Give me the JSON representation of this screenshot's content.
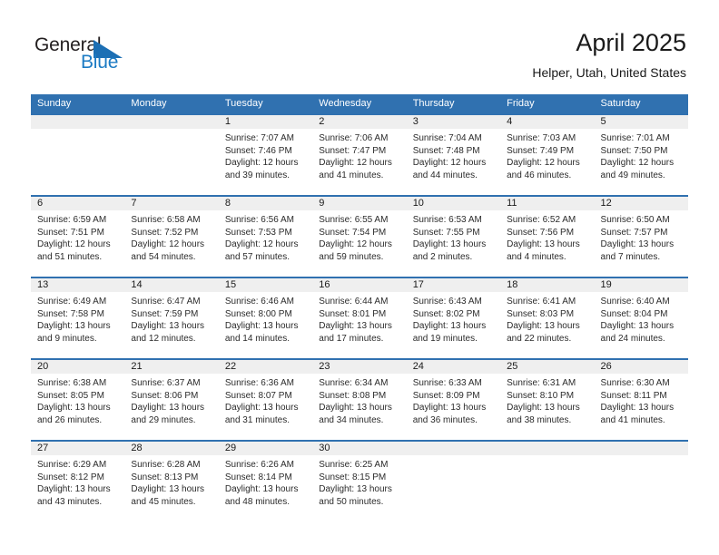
{
  "brand": {
    "name_part1": "General",
    "name_part2": "Blue",
    "triangle_color": "#1c6fb4",
    "text_color": "#231f20",
    "blue_text_color": "#1c7bc4"
  },
  "header": {
    "title": "April 2025",
    "subtitle": "Helper, Utah, United States"
  },
  "theme": {
    "header_blue": "#3071b0",
    "daynum_band": "#efefef",
    "cell_text": "#2b2b2b"
  },
  "weekdays": [
    "Sunday",
    "Monday",
    "Tuesday",
    "Wednesday",
    "Thursday",
    "Friday",
    "Saturday"
  ],
  "weeks": [
    {
      "days": [
        {
          "num": "",
          "l1": "",
          "l2": "",
          "l3": "",
          "l4": ""
        },
        {
          "num": "",
          "l1": "",
          "l2": "",
          "l3": "",
          "l4": ""
        },
        {
          "num": "1",
          "l1": "Sunrise: 7:07 AM",
          "l2": "Sunset: 7:46 PM",
          "l3": "Daylight: 12 hours",
          "l4": "and 39 minutes."
        },
        {
          "num": "2",
          "l1": "Sunrise: 7:06 AM",
          "l2": "Sunset: 7:47 PM",
          "l3": "Daylight: 12 hours",
          "l4": "and 41 minutes."
        },
        {
          "num": "3",
          "l1": "Sunrise: 7:04 AM",
          "l2": "Sunset: 7:48 PM",
          "l3": "Daylight: 12 hours",
          "l4": "and 44 minutes."
        },
        {
          "num": "4",
          "l1": "Sunrise: 7:03 AM",
          "l2": "Sunset: 7:49 PM",
          "l3": "Daylight: 12 hours",
          "l4": "and 46 minutes."
        },
        {
          "num": "5",
          "l1": "Sunrise: 7:01 AM",
          "l2": "Sunset: 7:50 PM",
          "l3": "Daylight: 12 hours",
          "l4": "and 49 minutes."
        }
      ]
    },
    {
      "days": [
        {
          "num": "6",
          "l1": "Sunrise: 6:59 AM",
          "l2": "Sunset: 7:51 PM",
          "l3": "Daylight: 12 hours",
          "l4": "and 51 minutes."
        },
        {
          "num": "7",
          "l1": "Sunrise: 6:58 AM",
          "l2": "Sunset: 7:52 PM",
          "l3": "Daylight: 12 hours",
          "l4": "and 54 minutes."
        },
        {
          "num": "8",
          "l1": "Sunrise: 6:56 AM",
          "l2": "Sunset: 7:53 PM",
          "l3": "Daylight: 12 hours",
          "l4": "and 57 minutes."
        },
        {
          "num": "9",
          "l1": "Sunrise: 6:55 AM",
          "l2": "Sunset: 7:54 PM",
          "l3": "Daylight: 12 hours",
          "l4": "and 59 minutes."
        },
        {
          "num": "10",
          "l1": "Sunrise: 6:53 AM",
          "l2": "Sunset: 7:55 PM",
          "l3": "Daylight: 13 hours",
          "l4": "and 2 minutes."
        },
        {
          "num": "11",
          "l1": "Sunrise: 6:52 AM",
          "l2": "Sunset: 7:56 PM",
          "l3": "Daylight: 13 hours",
          "l4": "and 4 minutes."
        },
        {
          "num": "12",
          "l1": "Sunrise: 6:50 AM",
          "l2": "Sunset: 7:57 PM",
          "l3": "Daylight: 13 hours",
          "l4": "and 7 minutes."
        }
      ]
    },
    {
      "days": [
        {
          "num": "13",
          "l1": "Sunrise: 6:49 AM",
          "l2": "Sunset: 7:58 PM",
          "l3": "Daylight: 13 hours",
          "l4": "and 9 minutes."
        },
        {
          "num": "14",
          "l1": "Sunrise: 6:47 AM",
          "l2": "Sunset: 7:59 PM",
          "l3": "Daylight: 13 hours",
          "l4": "and 12 minutes."
        },
        {
          "num": "15",
          "l1": "Sunrise: 6:46 AM",
          "l2": "Sunset: 8:00 PM",
          "l3": "Daylight: 13 hours",
          "l4": "and 14 minutes."
        },
        {
          "num": "16",
          "l1": "Sunrise: 6:44 AM",
          "l2": "Sunset: 8:01 PM",
          "l3": "Daylight: 13 hours",
          "l4": "and 17 minutes."
        },
        {
          "num": "17",
          "l1": "Sunrise: 6:43 AM",
          "l2": "Sunset: 8:02 PM",
          "l3": "Daylight: 13 hours",
          "l4": "and 19 minutes."
        },
        {
          "num": "18",
          "l1": "Sunrise: 6:41 AM",
          "l2": "Sunset: 8:03 PM",
          "l3": "Daylight: 13 hours",
          "l4": "and 22 minutes."
        },
        {
          "num": "19",
          "l1": "Sunrise: 6:40 AM",
          "l2": "Sunset: 8:04 PM",
          "l3": "Daylight: 13 hours",
          "l4": "and 24 minutes."
        }
      ]
    },
    {
      "days": [
        {
          "num": "20",
          "l1": "Sunrise: 6:38 AM",
          "l2": "Sunset: 8:05 PM",
          "l3": "Daylight: 13 hours",
          "l4": "and 26 minutes."
        },
        {
          "num": "21",
          "l1": "Sunrise: 6:37 AM",
          "l2": "Sunset: 8:06 PM",
          "l3": "Daylight: 13 hours",
          "l4": "and 29 minutes."
        },
        {
          "num": "22",
          "l1": "Sunrise: 6:36 AM",
          "l2": "Sunset: 8:07 PM",
          "l3": "Daylight: 13 hours",
          "l4": "and 31 minutes."
        },
        {
          "num": "23",
          "l1": "Sunrise: 6:34 AM",
          "l2": "Sunset: 8:08 PM",
          "l3": "Daylight: 13 hours",
          "l4": "and 34 minutes."
        },
        {
          "num": "24",
          "l1": "Sunrise: 6:33 AM",
          "l2": "Sunset: 8:09 PM",
          "l3": "Daylight: 13 hours",
          "l4": "and 36 minutes."
        },
        {
          "num": "25",
          "l1": "Sunrise: 6:31 AM",
          "l2": "Sunset: 8:10 PM",
          "l3": "Daylight: 13 hours",
          "l4": "and 38 minutes."
        },
        {
          "num": "26",
          "l1": "Sunrise: 6:30 AM",
          "l2": "Sunset: 8:11 PM",
          "l3": "Daylight: 13 hours",
          "l4": "and 41 minutes."
        }
      ]
    },
    {
      "days": [
        {
          "num": "27",
          "l1": "Sunrise: 6:29 AM",
          "l2": "Sunset: 8:12 PM",
          "l3": "Daylight: 13 hours",
          "l4": "and 43 minutes."
        },
        {
          "num": "28",
          "l1": "Sunrise: 6:28 AM",
          "l2": "Sunset: 8:13 PM",
          "l3": "Daylight: 13 hours",
          "l4": "and 45 minutes."
        },
        {
          "num": "29",
          "l1": "Sunrise: 6:26 AM",
          "l2": "Sunset: 8:14 PM",
          "l3": "Daylight: 13 hours",
          "l4": "and 48 minutes."
        },
        {
          "num": "30",
          "l1": "Sunrise: 6:25 AM",
          "l2": "Sunset: 8:15 PM",
          "l3": "Daylight: 13 hours",
          "l4": "and 50 minutes."
        },
        {
          "num": "",
          "l1": "",
          "l2": "",
          "l3": "",
          "l4": ""
        },
        {
          "num": "",
          "l1": "",
          "l2": "",
          "l3": "",
          "l4": ""
        },
        {
          "num": "",
          "l1": "",
          "l2": "",
          "l3": "",
          "l4": ""
        }
      ]
    }
  ]
}
